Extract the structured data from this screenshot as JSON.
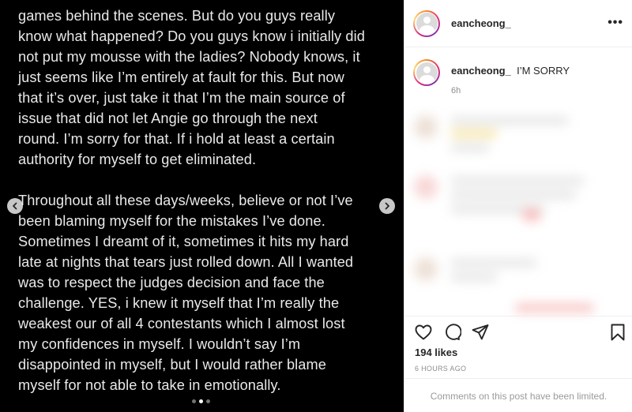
{
  "post_image": {
    "paragraph_1_lines": [
      "games behind the scenes. But do you guys really",
      "know what happened? Do you guys know i initially did",
      "not put my mousse with the ladies? Nobody knows, it",
      "just seems like I’m entirely at fault for this. But now",
      "that it’s over, just take it that I’m the main source of",
      "issue that did not let Angie go through the next",
      "round. I’m sorry for that. If i hold at least a certain",
      "authority for myself to get eliminated."
    ],
    "paragraph_2_lines": [
      "Throughout all these days/weeks, believe or not I’ve",
      "been blaming myself for the mistakes I’ve done.",
      "Sometimes I dreamt of it, sometimes it hits my hard",
      "late at nights that tears just rolled down. All I wanted",
      "was to respect the judges decision and face the",
      "challenge. YES, i knew it myself that I’m really the",
      "weakest our of all 4 contestants which I almost lost",
      "my confidences in myself.  I wouldn’t say I’m",
      "disappointed in myself, but I would rather blame",
      "myself for not able to take in emotionally."
    ],
    "carousel_dots": 3,
    "active_dot": 1
  },
  "header": {
    "username": "eancheong_",
    "more_icon": "more-horizontal-icon"
  },
  "caption": {
    "username": "eancheong_",
    "text": "I’M SORRY",
    "time": "6h"
  },
  "actions": {
    "icons": [
      "heart-icon",
      "comment-icon",
      "share-icon",
      "bookmark-icon"
    ],
    "likes": "194 likes",
    "posted": "6 HOURS AGO",
    "comments_limited": "Comments on this post have been limited."
  },
  "colors": {
    "viewer_bg": "#000000",
    "text_light": "#e9e9e9",
    "text_dark": "#262626",
    "muted": "#8e8e8e"
  }
}
